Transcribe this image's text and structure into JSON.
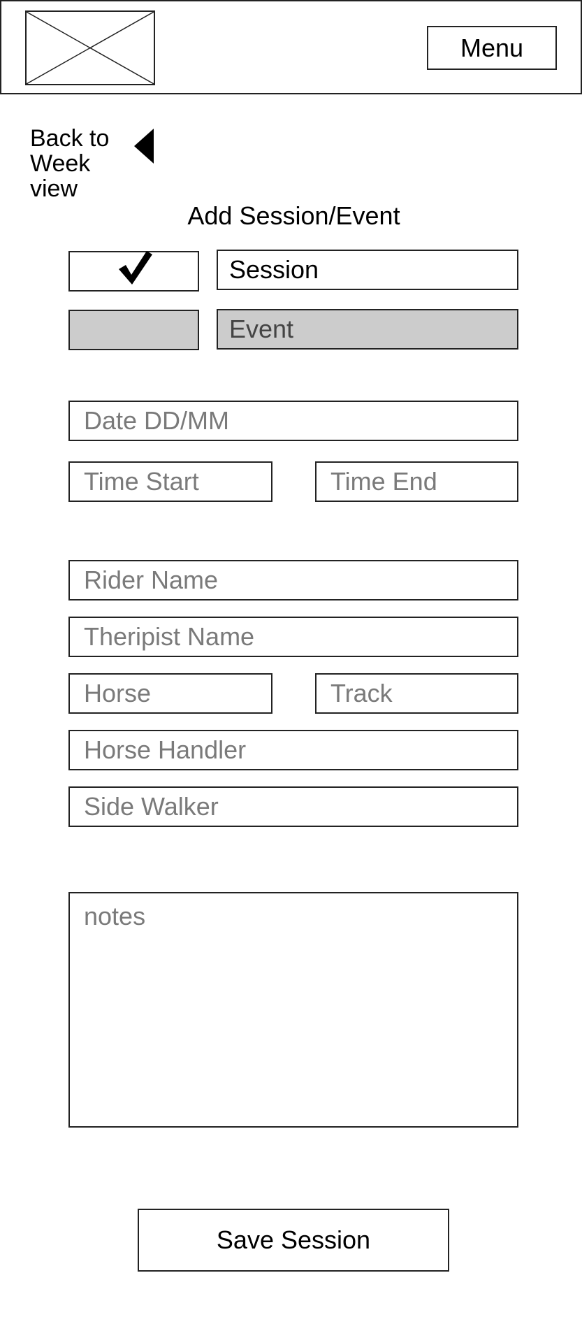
{
  "header": {
    "logo_icon": "image-placeholder-icon",
    "menu_label": "Menu"
  },
  "nav": {
    "back_label": "Back to Week view",
    "back_icon": "triangle-left-icon"
  },
  "form": {
    "title": "Add Session/Event",
    "type_options": [
      {
        "label": "Session",
        "checked": true
      },
      {
        "label": "Event",
        "checked": false
      }
    ],
    "check_icon": "checkmark-icon",
    "fields": {
      "date": {
        "placeholder": "Date DD/MM",
        "value": ""
      },
      "time_start": {
        "placeholder": "Time Start",
        "value": ""
      },
      "time_end": {
        "placeholder": "Time End",
        "value": ""
      },
      "rider_name": {
        "placeholder": "Rider Name",
        "value": ""
      },
      "therapist_name": {
        "placeholder": "Theripist Name",
        "value": ""
      },
      "horse": {
        "placeholder": "Horse",
        "value": ""
      },
      "track": {
        "placeholder": "Track",
        "value": ""
      },
      "horse_handler": {
        "placeholder": "Horse Handler",
        "value": ""
      },
      "side_walker": {
        "placeholder": "Side Walker",
        "value": ""
      },
      "notes": {
        "placeholder": "notes",
        "value": ""
      }
    },
    "save_label": "Save Session"
  },
  "colors": {
    "border": "#222222",
    "shaded": "#cccccc",
    "placeholder": "#7a7a7a"
  }
}
